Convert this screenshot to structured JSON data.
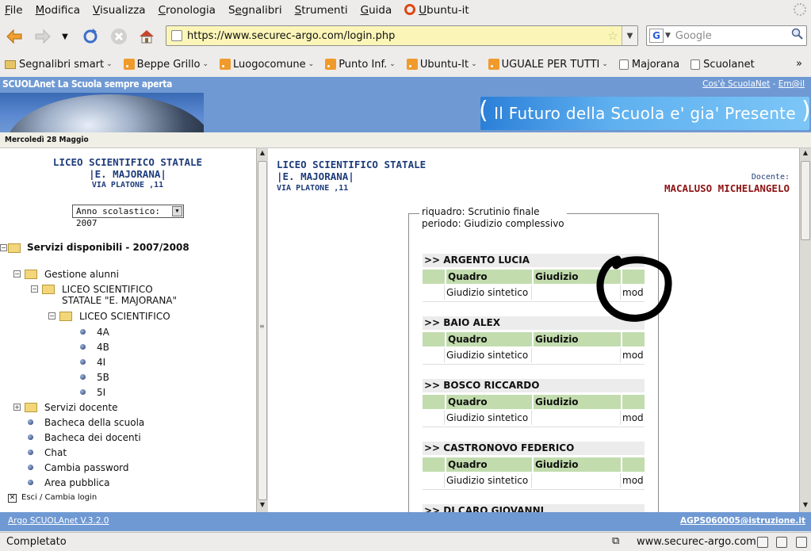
{
  "menu": {
    "items": [
      {
        "pre": "",
        "u": "F",
        "post": "ile"
      },
      {
        "pre": "",
        "u": "M",
        "post": "odifica"
      },
      {
        "pre": "",
        "u": "V",
        "post": "isualizza"
      },
      {
        "pre": "",
        "u": "C",
        "post": "ronologia"
      },
      {
        "pre": "S",
        "u": "e",
        "post": "gnalibri"
      },
      {
        "pre": "",
        "u": "S",
        "post": "trumenti"
      },
      {
        "pre": "",
        "u": "G",
        "post": "uida"
      },
      {
        "pre": "",
        "u": "U",
        "post": "buntu-it"
      }
    ]
  },
  "nav": {
    "url": "https://www.securec-argo.com/login.php",
    "search_placeholder": "Google",
    "search_engine_letter": "G"
  },
  "bookmarks": [
    {
      "label": "Segnalibri smart",
      "type": "folder",
      "dropdown": true
    },
    {
      "label": "Beppe Grillo",
      "type": "rss",
      "dropdown": true
    },
    {
      "label": "Luogocomune",
      "type": "rss",
      "dropdown": true
    },
    {
      "label": "Punto Inf.",
      "type": "rss",
      "dropdown": true
    },
    {
      "label": "Ubuntu-It",
      "type": "rss",
      "dropdown": true
    },
    {
      "label": "UGUALE PER TUTTI",
      "type": "rss",
      "dropdown": true
    },
    {
      "label": "Majorana",
      "type": "page",
      "dropdown": false
    },
    {
      "label": "Scuolanet",
      "type": "page",
      "dropdown": false
    }
  ],
  "bookmarks_overflow": "»",
  "site": {
    "title": "SCUOLAnet La Scuola sempre aperta",
    "link_cose": "Cos'è ScuolaNet",
    "link_sep": " - ",
    "link_email": "Em@il",
    "banner": "Il Futuro della Scuola e' gia' Presente",
    "date": "Mercoledì 28 Maggio"
  },
  "left": {
    "school_line1": "LICEO SCIENTIFICO STATALE",
    "school_line2": "|E. MAJORANA|",
    "school_line3": "VIA PLATONE ,11",
    "year_select": "Anno scolastico: 2007",
    "services_title": "Servizi disponibili - 2007/2008",
    "gestione": "Gestione alunni",
    "liceo_statale_1": "LICEO SCIENTIFICO",
    "liceo_statale_2": "STATALE \"E. MAJORANA\"",
    "liceo": "LICEO SCIENTIFICO",
    "classes": [
      "4A",
      "4B",
      "4I",
      "5B",
      "5I"
    ],
    "servizi_docente": "Servizi docente",
    "links": [
      "Bacheca della scuola",
      "Bacheca dei docenti",
      "Chat",
      "Cambia password",
      "Area pubblica"
    ],
    "logout": "Esci / Cambia login"
  },
  "right": {
    "school_line1": "LICEO SCIENTIFICO STATALE",
    "school_line2": "|E. MAJORANA|",
    "school_line3": "VIA PLATONE ,11",
    "docente_label": "Docente:",
    "docente_name": "MACALUSO MICHELANGELO",
    "riquadro": "riquadro: Scrutinio finale",
    "periodo": "periodo: Giudizio complessivo",
    "col_quadro": "Quadro",
    "col_giudizio": "Giudizio",
    "row_label": "Giudizio sintetico",
    "row_action": "mod",
    "students": [
      ">> ARGENTO LUCIA",
      ">> BAIO ALEX",
      ">> BOSCO RICCARDO",
      ">> CASTRONOVO FEDERICO",
      ">> DI CARO GIOVANNI"
    ]
  },
  "footer": {
    "version": "Argo SCUOLAnet V.3.2.0",
    "email": "AGPS060005@istruzione.it"
  },
  "status": {
    "text": "Completato",
    "host": "www.securec-argo.com"
  }
}
